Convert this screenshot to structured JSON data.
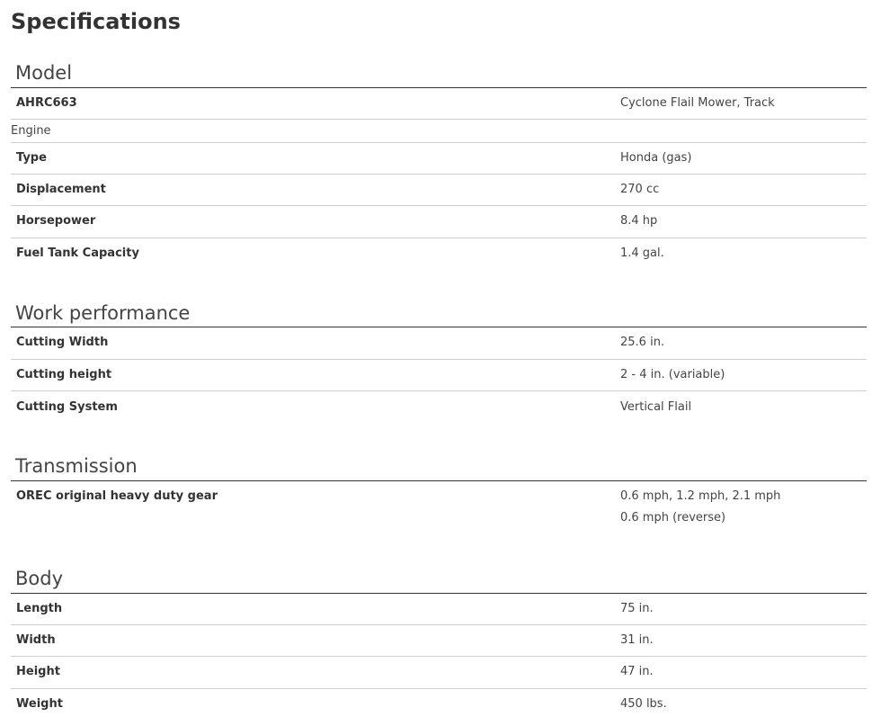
{
  "page_title": "Specifications",
  "sections": {
    "model": {
      "title": "Model",
      "rows": [
        {
          "label": "AHRC663",
          "value": "Cyclone Flail Mower, Track"
        }
      ]
    },
    "engine": {
      "title": "Engine",
      "rows": [
        {
          "label": "Type",
          "value": "Honda (gas)"
        },
        {
          "label": "Displacement",
          "value": "270 cc"
        },
        {
          "label": "Horsepower",
          "value": "8.4 hp"
        },
        {
          "label": "Fuel Tank Capacity",
          "value": "1.4 gal."
        }
      ]
    },
    "work_performance": {
      "title": "Work performance",
      "rows": [
        {
          "label": "Cutting Width",
          "value": "25.6 in."
        },
        {
          "label": "Cutting height",
          "value": "2 - 4 in. (variable)"
        },
        {
          "label": "Cutting System",
          "value": "Vertical Flail"
        }
      ]
    },
    "transmission": {
      "title": "Transmission",
      "rows": [
        {
          "label": "OREC original heavy duty gear",
          "value": "0.6 mph, 1.2 mph, 2.1 mph",
          "value_2": "0.6 mph (reverse)"
        }
      ]
    },
    "body": {
      "title": "Body",
      "rows": [
        {
          "label": "Length",
          "value": "75 in."
        },
        {
          "label": "Width",
          "value": "31 in."
        },
        {
          "label": "Height",
          "value": "47 in."
        },
        {
          "label": "Weight",
          "value": "450 lbs."
        }
      ]
    }
  }
}
